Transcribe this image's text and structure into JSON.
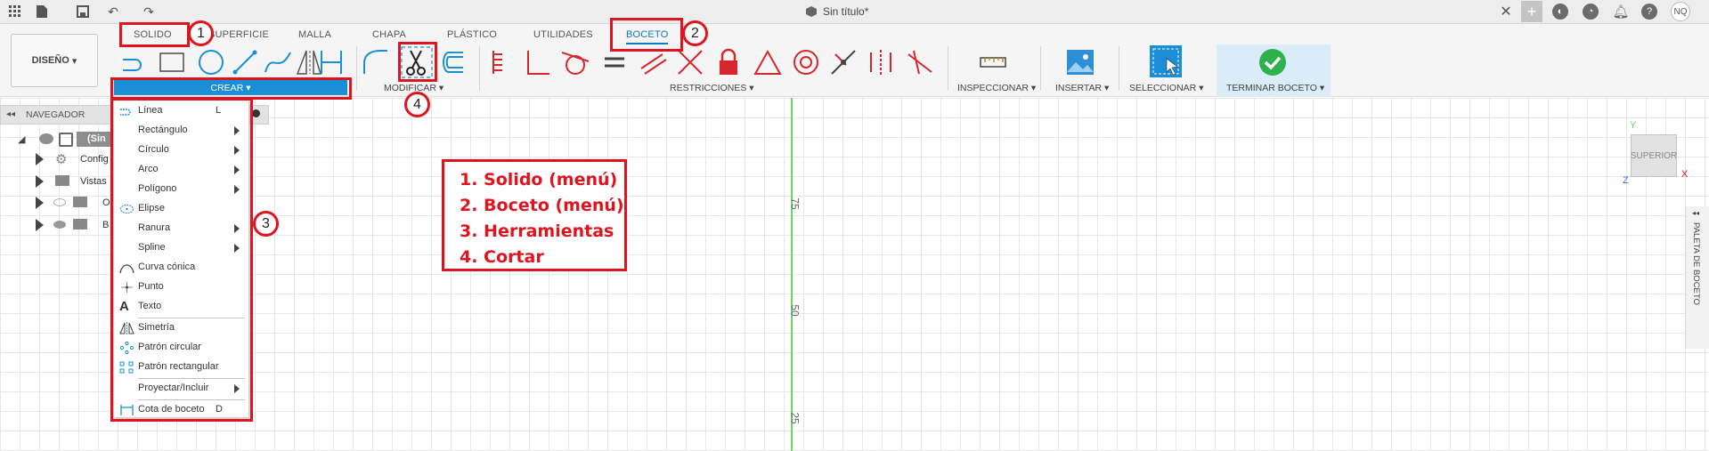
{
  "app": {
    "title": "Sin título*",
    "user_initials": "NQ"
  },
  "tabs": [
    "SOLIDO",
    "SUPERFICIE",
    "MALLA",
    "CHAPA",
    "PLÁSTICO",
    "UTILIDADES",
    "BOCETO"
  ],
  "workspace": "DISEÑO",
  "groups": {
    "crear": "CREAR",
    "modificar": "MODIFICAR",
    "restricciones": "RESTRICCIONES",
    "inspeccionar": "INSPECCIONAR",
    "insertar": "INSERTAR",
    "seleccionar": "SELECCIONAR",
    "terminar": "TERMINAR BOCETO"
  },
  "navigator": {
    "title": "NAVEGADOR",
    "root": "(Sin",
    "items": [
      "Config",
      "Vistas",
      "O",
      "B"
    ]
  },
  "crear_menu": [
    {
      "label": "Línea",
      "shortcut": "L",
      "submenu": false,
      "icon": "line-icon"
    },
    {
      "label": "Rectángulo",
      "shortcut": "",
      "submenu": true,
      "icon": ""
    },
    {
      "label": "Círculo",
      "shortcut": "",
      "submenu": true,
      "icon": ""
    },
    {
      "label": "Arco",
      "shortcut": "",
      "submenu": true,
      "icon": ""
    },
    {
      "label": "Polígono",
      "shortcut": "",
      "submenu": true,
      "icon": ""
    },
    {
      "label": "Elipse",
      "shortcut": "",
      "submenu": false,
      "icon": "ellipse-icon"
    },
    {
      "label": "Ranura",
      "shortcut": "",
      "submenu": true,
      "icon": ""
    },
    {
      "label": "Spline",
      "shortcut": "",
      "submenu": true,
      "icon": ""
    },
    {
      "label": "Curva cónica",
      "shortcut": "",
      "submenu": false,
      "icon": "conic-curve-icon"
    },
    {
      "label": "Punto",
      "shortcut": "",
      "submenu": false,
      "icon": "point-icon"
    },
    {
      "label": "Texto",
      "shortcut": "",
      "submenu": false,
      "icon": "text-icon"
    },
    {
      "label": "Simetría",
      "shortcut": "",
      "submenu": false,
      "icon": "mirror-icon"
    },
    {
      "label": "Patrón circular",
      "shortcut": "",
      "submenu": false,
      "icon": "circular-pattern-icon"
    },
    {
      "label": "Patrón rectangular",
      "shortcut": "",
      "submenu": false,
      "icon": "rectangular-pattern-icon"
    },
    {
      "label": "Proyectar/Incluir",
      "shortcut": "",
      "submenu": true,
      "icon": ""
    },
    {
      "label": "Cota de boceto",
      "shortcut": "D",
      "submenu": false,
      "icon": "sketch-dimension-icon"
    }
  ],
  "annotations": {
    "markers": [
      "1",
      "2",
      "3",
      "4"
    ],
    "legend": [
      "1. Solido (menú)",
      "2. Boceto (menú)",
      "3. Herramientas",
      "4. Cortar"
    ]
  },
  "canvas": {
    "axis_numbers": [
      "75",
      "50",
      "25"
    ],
    "viewcube_label": "SUPERIOR",
    "axis_x": "X",
    "axis_y": "Y",
    "axis_z": "Z",
    "palette_label": "PALETA DE BOCETO"
  },
  "colors": {
    "accent": "#0a7bc4",
    "annotation_red": "#e0141e",
    "finish_green": "#2fb24c"
  }
}
